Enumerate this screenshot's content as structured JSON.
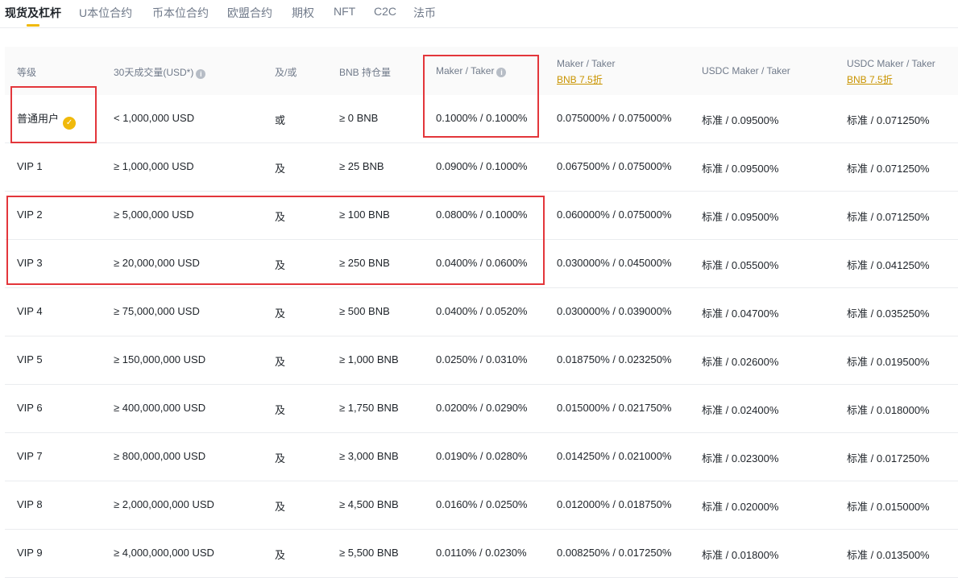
{
  "tabs": [
    {
      "label": "现货及杠杆",
      "active": true
    },
    {
      "label": "U本位合约"
    },
    {
      "label": "币本位合约"
    },
    {
      "label": "欧盟合约"
    },
    {
      "label": "期权"
    },
    {
      "label": "NFT"
    },
    {
      "label": "C2C"
    },
    {
      "label": "法币"
    }
  ],
  "header": {
    "level": "等级",
    "volume": "30天成交量(USD*)",
    "andor": "及/或",
    "bnb": "BNB 持仓量",
    "maker_taker": "Maker / Taker",
    "maker_taker_bnb": "Maker / Taker",
    "bnb_discount": "BNB 7.5折",
    "usdc_maker_taker": "USDC Maker / Taker",
    "usdc_maker_taker_bnb": "USDC Maker / Taker",
    "usdc_bnb_discount": "BNB 7.5折"
  },
  "rows": [
    {
      "level": "普通用户",
      "volume": "< 1,000,000 USD",
      "andor": "或",
      "bnb": "≥ 0 BNB",
      "mt": "0.1000% / 0.1000%",
      "mt_bnb": "0.075000% / 0.075000%",
      "usdc": "标准 / 0.09500%",
      "usdc_bnb": "标准 / 0.071250%"
    },
    {
      "level": "VIP 1",
      "volume": "≥ 1,000,000 USD",
      "andor": "及",
      "bnb": "≥ 25 BNB",
      "mt": "0.0900% / 0.1000%",
      "mt_bnb": "0.067500% / 0.075000%",
      "usdc": "标准 / 0.09500%",
      "usdc_bnb": "标准 / 0.071250%"
    },
    {
      "level": "VIP 2",
      "volume": "≥ 5,000,000 USD",
      "andor": "及",
      "bnb": "≥ 100 BNB",
      "mt": "0.0800% / 0.1000%",
      "mt_bnb": "0.060000% / 0.075000%",
      "usdc": "标准 / 0.09500%",
      "usdc_bnb": "标准 / 0.071250%"
    },
    {
      "level": "VIP 3",
      "volume": "≥ 20,000,000 USD",
      "andor": "及",
      "bnb": "≥ 250 BNB",
      "mt": "0.0400% / 0.0600%",
      "mt_bnb": "0.030000% / 0.045000%",
      "usdc": "标准 / 0.05500%",
      "usdc_bnb": "标准 / 0.041250%"
    },
    {
      "level": "VIP 4",
      "volume": "≥ 75,000,000 USD",
      "andor": "及",
      "bnb": "≥ 500 BNB",
      "mt": "0.0400% / 0.0520%",
      "mt_bnb": "0.030000% / 0.039000%",
      "usdc": "标准 / 0.04700%",
      "usdc_bnb": "标准 / 0.035250%"
    },
    {
      "level": "VIP 5",
      "volume": "≥ 150,000,000 USD",
      "andor": "及",
      "bnb": "≥ 1,000 BNB",
      "mt": "0.0250% / 0.0310%",
      "mt_bnb": "0.018750% / 0.023250%",
      "usdc": "标准 / 0.02600%",
      "usdc_bnb": "标准 / 0.019500%"
    },
    {
      "level": "VIP 6",
      "volume": "≥ 400,000,000 USD",
      "andor": "及",
      "bnb": "≥ 1,750 BNB",
      "mt": "0.0200% / 0.0290%",
      "mt_bnb": "0.015000% / 0.021750%",
      "usdc": "标准 / 0.02400%",
      "usdc_bnb": "标准 / 0.018000%"
    },
    {
      "level": "VIP 7",
      "volume": "≥ 800,000,000 USD",
      "andor": "及",
      "bnb": "≥ 3,000 BNB",
      "mt": "0.0190% / 0.0280%",
      "mt_bnb": "0.014250% / 0.021000%",
      "usdc": "标准 / 0.02300%",
      "usdc_bnb": "标准 / 0.017250%"
    },
    {
      "level": "VIP 8",
      "volume": "≥ 2,000,000,000 USD",
      "andor": "及",
      "bnb": "≥ 4,500 BNB",
      "mt": "0.0160% / 0.0250%",
      "mt_bnb": "0.012000% / 0.018750%",
      "usdc": "标准 / 0.02000%",
      "usdc_bnb": "标准 / 0.015000%"
    },
    {
      "level": "VIP 9",
      "volume": "≥ 4,000,000,000 USD",
      "andor": "及",
      "bnb": "≥ 5,500 BNB",
      "mt": "0.0110% / 0.0230%",
      "mt_bnb": "0.008250% / 0.017250%",
      "usdc": "标准 / 0.01800%",
      "usdc_bnb": "标准 / 0.013500%"
    }
  ],
  "colors": {
    "accent": "#f0b90b",
    "discount": "#c99400",
    "highlight_box": "#e3363b",
    "header_bg": "#fafafa"
  },
  "icons": {
    "info": "info-icon",
    "verified": "verified-badge-icon"
  }
}
